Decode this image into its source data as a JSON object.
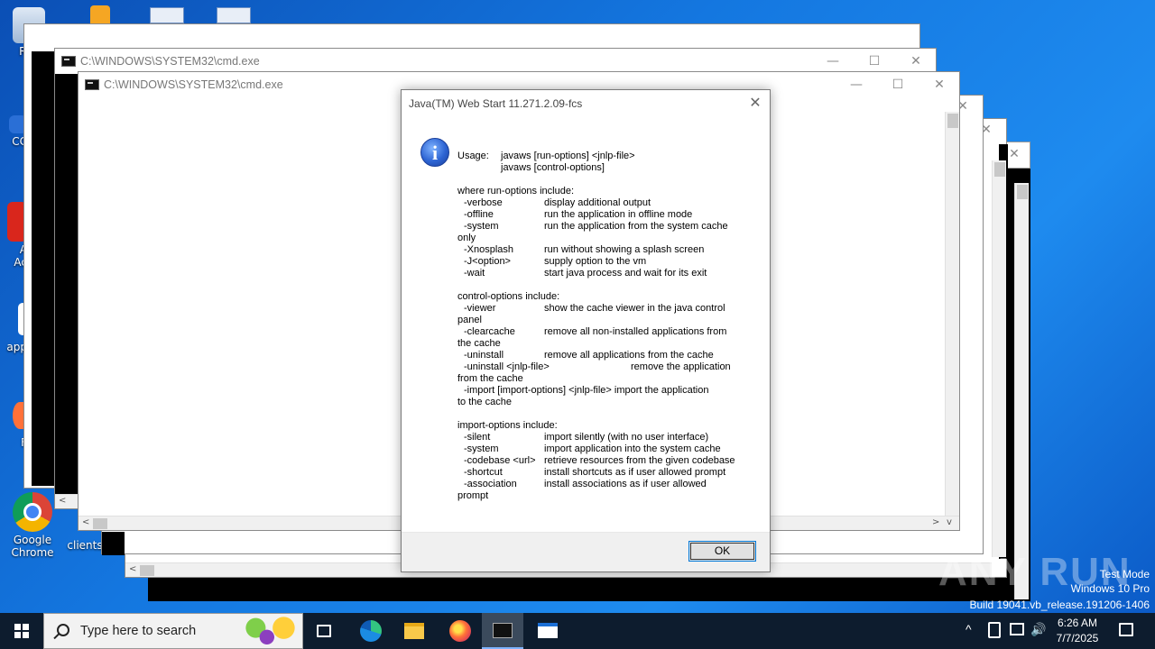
{
  "desktop": {
    "icons": [
      {
        "label": "Rec",
        "icon": "recycle-bin-icon"
      },
      {
        "label": "CC",
        "icon": "shortcut-icon"
      },
      {
        "label": "A",
        "icon": "acrobat-icon"
      },
      {
        "label": "Ac",
        "icon": "acrobat-icon"
      },
      {
        "label": "app",
        "icon": "file-icon"
      },
      {
        "label": "F",
        "icon": "firefox-icon"
      },
      {
        "label": "Google Chrome",
        "icon": "chrome-icon"
      },
      {
        "label": "clients",
        "icon": "file-icon"
      }
    ]
  },
  "windows": {
    "cmd_back": {
      "title": "C:\\WINDOWS\\SYSTEM32\\cmd.exe"
    },
    "cmd_front": {
      "title": "C:\\WINDOWS\\SYSTEM32\\cmd.exe"
    }
  },
  "dialog": {
    "title": "Java(TM) Web Start 11.271.2.09-fcs",
    "icon": "info-icon",
    "lines": [
      {
        "k": "Usage:",
        "v": "javaws [run-options] <jnlp-file>",
        "type": "usage"
      },
      {
        "k": "",
        "v": "javaws [control-options]",
        "type": "usage"
      },
      {
        "type": "blank"
      },
      {
        "k": "where run-options include:",
        "v": "",
        "type": "head"
      },
      {
        "k": "-verbose",
        "v": "display additional output",
        "type": "opt"
      },
      {
        "k": "-offline",
        "v": "run the application in offline mode",
        "type": "opt"
      },
      {
        "k": "-system",
        "v": "run the application from the system cache",
        "type": "opt"
      },
      {
        "k": "only",
        "v": "",
        "type": "wrap"
      },
      {
        "k": "-Xnosplash",
        "v": "run without showing a splash screen",
        "type": "opt"
      },
      {
        "k": "-J<option>",
        "v": "supply option to the vm",
        "type": "opt"
      },
      {
        "k": "-wait",
        "v": "start java process and wait for its exit",
        "type": "opt"
      },
      {
        "type": "blank"
      },
      {
        "k": "control-options include:",
        "v": "",
        "type": "head"
      },
      {
        "k": "-viewer",
        "v": "show the cache viewer in the java control",
        "type": "opt"
      },
      {
        "k": "panel",
        "v": "",
        "type": "wrap"
      },
      {
        "k": "-clearcache",
        "v": "remove all non-installed applications from",
        "type": "opt"
      },
      {
        "k": "the cache",
        "v": "",
        "type": "wrap"
      },
      {
        "k": "-uninstall",
        "v": "remove all applications from the cache",
        "type": "opt"
      },
      {
        "k": "-uninstall <jnlp-file>",
        "v": "remove the application",
        "type": "optwide"
      },
      {
        "k": "from the cache",
        "v": "",
        "type": "wrap"
      },
      {
        "k": "-import [import-options] <jnlp-file> import the application",
        "v": "",
        "type": "optfull"
      },
      {
        "k": "to the cache",
        "v": "",
        "type": "wrap"
      },
      {
        "type": "blank"
      },
      {
        "k": "import-options include:",
        "v": "",
        "type": "head"
      },
      {
        "k": "-silent",
        "v": "import silently (with no user interface)",
        "type": "opt"
      },
      {
        "k": "-system",
        "v": "import application into the system cache",
        "type": "opt"
      },
      {
        "k": "-codebase <url>",
        "v": "retrieve resources from the given codebase",
        "type": "opt"
      },
      {
        "k": "-shortcut",
        "v": "install shortcuts as if user allowed prompt",
        "type": "opt"
      },
      {
        "k": "-association",
        "v": "install associations as if user allowed",
        "type": "opt"
      },
      {
        "k": "prompt",
        "v": "",
        "type": "wrap"
      }
    ],
    "ok_label": "OK"
  },
  "taskbar": {
    "search_placeholder": "Type here to search",
    "apps": [
      "task-view-icon",
      "edge-icon",
      "file-explorer-icon",
      "firefox-icon",
      "cmd-icon",
      "app-window-icon"
    ],
    "clock_time": "6:26 AM",
    "clock_date": "7/7/2025"
  },
  "watermark": {
    "line1": "Test Mode",
    "line2": "Windows 10 Pro",
    "line3": "Build 19041.vb_release.191206-1406",
    "logo_text": "ANY RUN"
  }
}
